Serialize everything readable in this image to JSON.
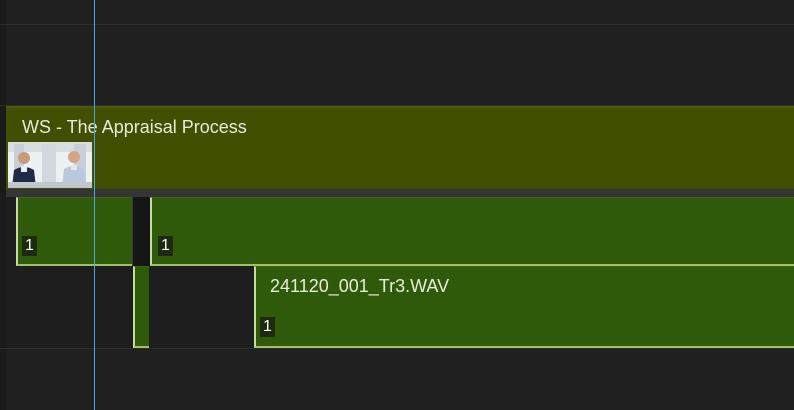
{
  "video_track": {
    "clip_title": "WS - The Appraisal Process",
    "thumbnail_icon": "two-people-seated-thumbnail"
  },
  "audio_track_1": {
    "clip_a_channel": "1",
    "clip_b_channel": "1"
  },
  "audio_track_2": {
    "clip_name": "241120_001_Tr3.WAV",
    "clip_channel": "1"
  },
  "colors": {
    "video_clip": "#405000",
    "audio_clip": "#2f5a0a",
    "playhead": "#4aa6e8",
    "background": "#202020"
  }
}
